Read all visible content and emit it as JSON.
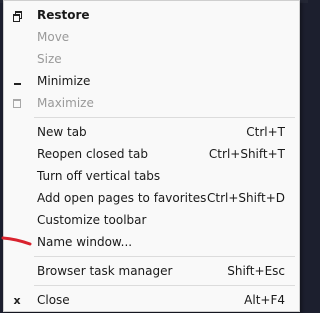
{
  "menu": {
    "window_section": [
      {
        "label": "Restore",
        "icon": "restore-icon",
        "enabled": true,
        "bold": true
      },
      {
        "label": "Move",
        "icon": "",
        "enabled": false
      },
      {
        "label": "Size",
        "icon": "",
        "enabled": false
      },
      {
        "label": "Minimize",
        "icon": "minimize-icon",
        "enabled": true
      },
      {
        "label": "Maximize",
        "icon": "maximize-icon",
        "enabled": false
      }
    ],
    "browser_section": [
      {
        "label": "New tab",
        "shortcut": "Ctrl+T"
      },
      {
        "label": "Reopen closed tab",
        "shortcut": "Ctrl+Shift+T"
      },
      {
        "label": "Turn off vertical tabs",
        "shortcut": ""
      },
      {
        "label": "Add open pages to favorites",
        "shortcut": "Ctrl+Shift+D"
      },
      {
        "label": "Customize toolbar",
        "shortcut": ""
      },
      {
        "label": "Name window...",
        "shortcut": ""
      }
    ],
    "tools_section": [
      {
        "label": "Browser task manager",
        "shortcut": "Shift+Esc"
      }
    ],
    "close_section": [
      {
        "label": "Close",
        "shortcut": "Alt+F4",
        "icon": "close-icon"
      }
    ]
  },
  "annotation": {
    "color": "#d9232e"
  }
}
